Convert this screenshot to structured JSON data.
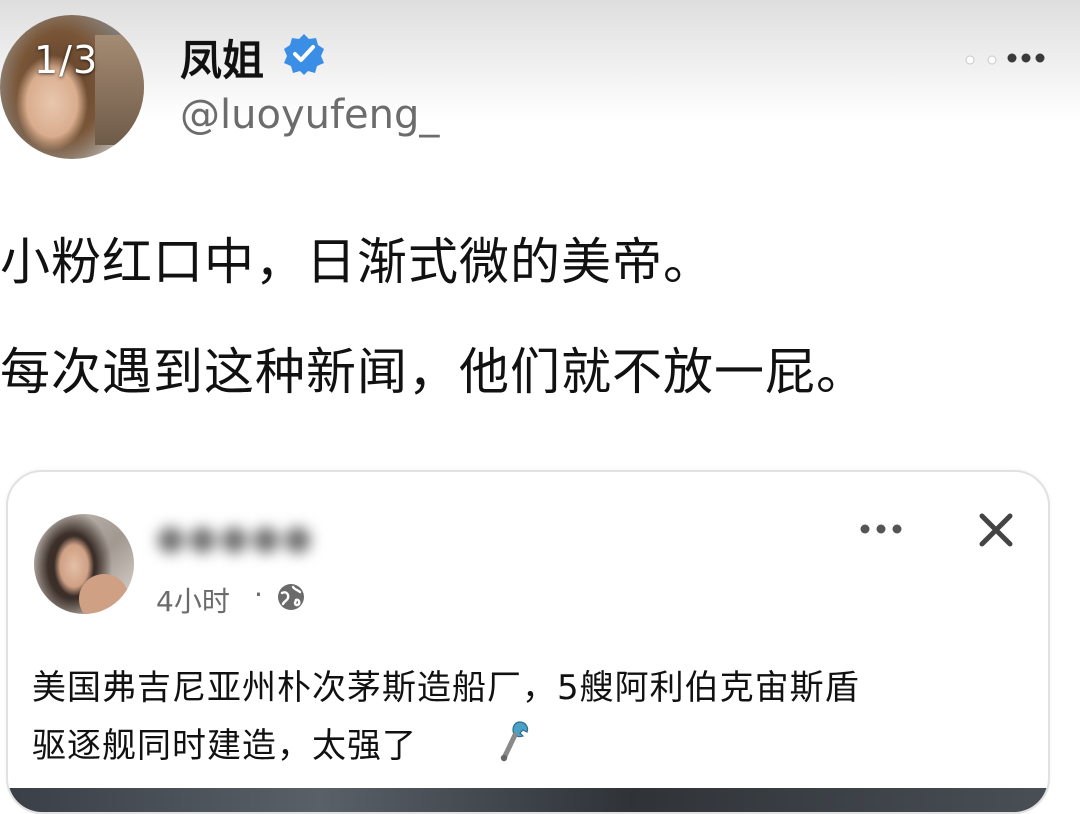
{
  "header": {
    "image_counter": "1/3",
    "display_name": "凤姐",
    "handle": "@luoyufeng_"
  },
  "tweet": {
    "lines": [
      "小粉红口中，日渐式微的美帝。",
      "每次遇到这种新闻，他们就不放一屁。"
    ]
  },
  "embedded_post": {
    "author_blurred": "●●●●●",
    "time": "4小时",
    "separator": "·",
    "text_lines": [
      "美国弗吉尼亚州朴次茅斯造船厂，5艘阿利伯克宙斯盾",
      "驱逐舰同时建造，太强了"
    ]
  },
  "icons": {
    "verified": "verified-badge-icon",
    "more": "more-horizontal-icon",
    "close": "close-icon",
    "globe": "globe-icon",
    "emoji": "wrench-icon"
  },
  "colors": {
    "verified_blue": "#3b8ee6",
    "text_primary": "#111111",
    "text_secondary": "#6b6b6b",
    "card_border": "#e1e1e1"
  }
}
